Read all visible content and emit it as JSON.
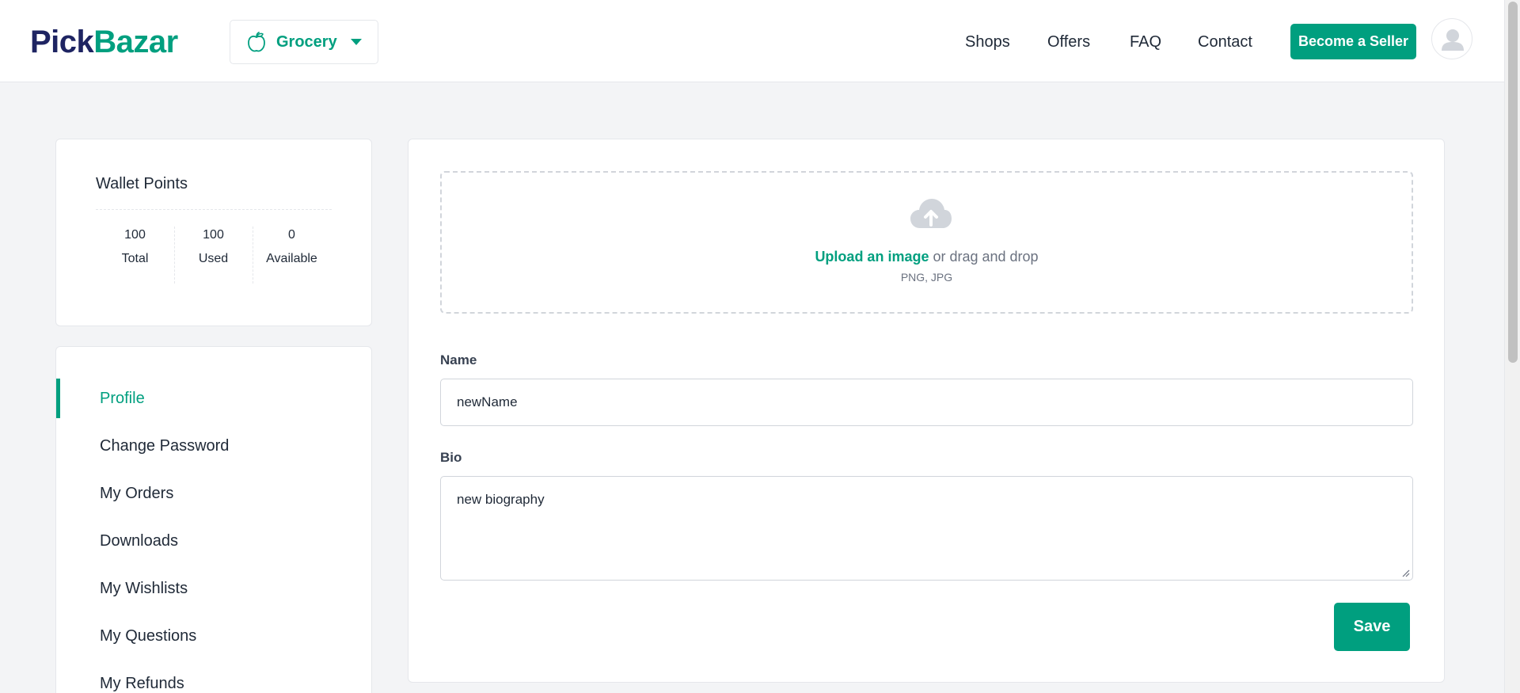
{
  "brand": {
    "part1": "Pick",
    "part2": "Bazar",
    "colors": {
      "dark": "#1e2462",
      "accent": "#009f7f"
    }
  },
  "type_selector": {
    "label": "Grocery",
    "icon": "apple-icon"
  },
  "nav": {
    "shops": "Shops",
    "offers": "Offers",
    "faq": "FAQ",
    "contact": "Contact"
  },
  "header": {
    "become_seller": "Become a Seller"
  },
  "wallet": {
    "title": "Wallet Points",
    "stats": [
      {
        "value": "100",
        "label": "Total"
      },
      {
        "value": "100",
        "label": "Used"
      },
      {
        "value": "0",
        "label": "Available"
      }
    ]
  },
  "sidebar": {
    "items": [
      {
        "label": "Profile",
        "active": true
      },
      {
        "label": "Change Password"
      },
      {
        "label": "My Orders"
      },
      {
        "label": "Downloads"
      },
      {
        "label": "My Wishlists"
      },
      {
        "label": "My Questions"
      },
      {
        "label": "My Refunds"
      }
    ]
  },
  "upload": {
    "link_text": "Upload an image",
    "rest_text": " or drag and drop",
    "formats": "PNG, JPG",
    "icon": "cloud-upload-icon"
  },
  "form": {
    "name_label": "Name",
    "name_value": "newName",
    "bio_label": "Bio",
    "bio_value": "new biography",
    "save_label": "Save"
  }
}
